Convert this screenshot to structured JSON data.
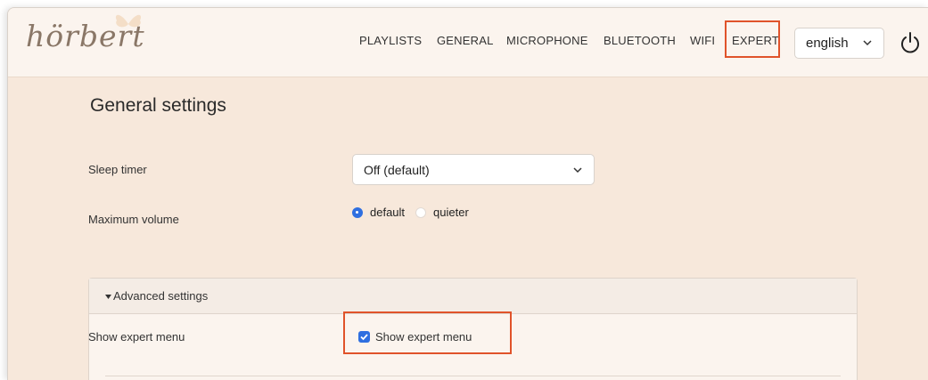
{
  "app": {
    "logo_text": "hörbert"
  },
  "nav": {
    "items": [
      "PLAYLISTS",
      "GENERAL",
      "MICROPHONE",
      "BLUETOOTH",
      "WIFI",
      "EXPERT"
    ],
    "language": "english"
  },
  "main": {
    "title": "General settings",
    "sleep_timer": {
      "label": "Sleep timer",
      "value": "Off (default)"
    },
    "max_volume": {
      "label": "Maximum volume",
      "options": [
        "default",
        "quieter"
      ],
      "selected": "default"
    },
    "advanced": {
      "header": "Advanced settings",
      "show_expert": {
        "label": "Show expert menu",
        "checkbox_label": "Show expert menu",
        "checked": true
      }
    }
  },
  "colors": {
    "accent": "#2f6fe0",
    "highlight": "#e0532a",
    "background": "#f7e8db"
  },
  "icons": {
    "power": "power-icon",
    "chevron": "chevron-down-icon",
    "caret": "caret-down-icon"
  }
}
